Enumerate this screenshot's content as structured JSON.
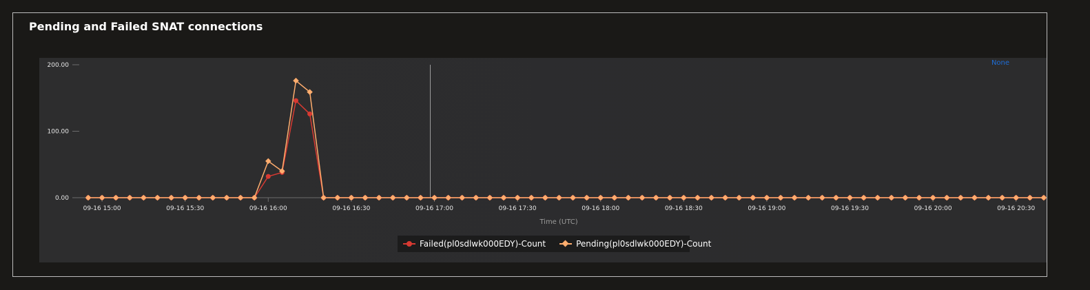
{
  "panel": {
    "title": "Pending and Failed SNAT connections"
  },
  "reset_link": "None",
  "colors": {
    "failed": "#d83a32",
    "pending": "#ffad6e",
    "cursor": "#9b9b9b",
    "axis": "#6d6d6d"
  },
  "chart_data": {
    "type": "line",
    "title": "Pending and Failed SNAT connections",
    "xlabel": "Time (UTC)",
    "ylabel": "",
    "ylim": [
      0,
      200
    ],
    "y_ticks": [
      "0.00",
      "100.00",
      "200.00"
    ],
    "x_ticks": [
      "09-16 15:00",
      "09-16 15:30",
      "09-16 16:00",
      "09-16 16:30",
      "09-16 17:00",
      "09-16 17:30",
      "09-16 18:00",
      "09-16 18:30",
      "09-16 19:00",
      "09-16 19:30",
      "09-16 20:00",
      "09-16 20:30"
    ],
    "x_start": "09-16 14:55",
    "x_interval_minutes": 5,
    "legend_position": "bottom-center",
    "cursor_at": "09-16 17:00",
    "series": [
      {
        "name": "Failed(pl0sdlwk000EDY)-Count",
        "marker": "circle",
        "values": [
          0,
          0,
          0,
          0,
          0,
          0,
          0,
          0,
          0,
          0,
          0,
          0,
          0,
          32,
          38,
          146,
          126,
          0,
          0,
          0,
          0,
          0,
          0,
          0,
          0,
          0,
          0,
          0,
          0,
          0,
          0,
          0,
          0,
          0,
          0,
          0,
          0,
          0,
          0,
          0,
          0,
          0,
          0,
          0,
          0,
          0,
          0,
          0,
          0,
          0,
          0,
          0,
          0,
          0,
          0,
          0,
          0,
          0,
          0,
          0,
          0,
          0,
          0,
          0,
          0,
          0,
          0,
          0,
          0,
          0
        ]
      },
      {
        "name": "Pending(pl0sdlwk000EDY)-Count",
        "marker": "diamond",
        "values": [
          0,
          0,
          0,
          0,
          0,
          0,
          0,
          0,
          0,
          0,
          0,
          0,
          0,
          55,
          40,
          176,
          159,
          0,
          0,
          0,
          0,
          0,
          0,
          0,
          0,
          0,
          0,
          0,
          0,
          0,
          0,
          0,
          0,
          0,
          0,
          0,
          0,
          0,
          0,
          0,
          0,
          0,
          0,
          0,
          0,
          0,
          0,
          0,
          0,
          0,
          0,
          0,
          0,
          0,
          0,
          0,
          0,
          0,
          0,
          0,
          0,
          0,
          0,
          0,
          0,
          0,
          0,
          0,
          0,
          0
        ]
      }
    ]
  }
}
